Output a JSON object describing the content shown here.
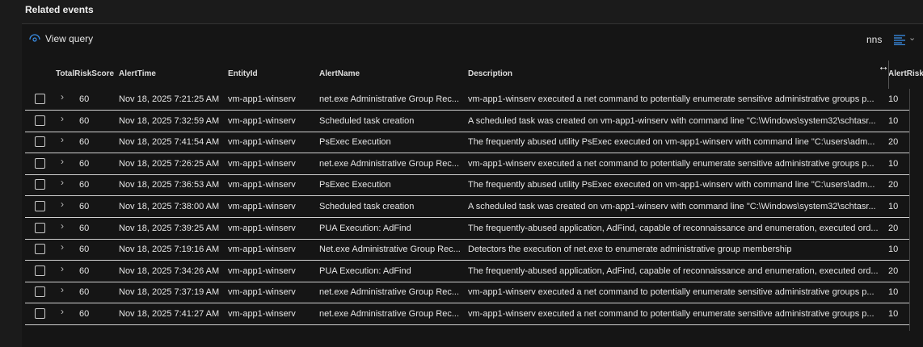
{
  "section_title": "Related events",
  "toolbar": {
    "view_query": "View query",
    "columns_label": "nns"
  },
  "columns": [
    "TotalRiskScore",
    "AlertTime",
    "EntityId",
    "AlertName",
    "Description",
    "AlertRiskS"
  ],
  "rows": [
    [
      "60",
      "Nov 18, 2025 7:21:25 AM",
      "vm-app1-winserv",
      "net.exe Administrative Group Rec...",
      "vm-app1-winserv executed a net command to potentially enumerate sensitive administrative groups p...",
      "10"
    ],
    [
      "60",
      "Nov 18, 2025 7:32:59 AM",
      "vm-app1-winserv",
      "Scheduled task creation",
      "A scheduled task was created on vm-app1-winserv with command line \"C:\\Windows\\system32\\schtasr...",
      "10"
    ],
    [
      "60",
      "Nov 18, 2025 7:41:54 AM",
      "vm-app1-winserv",
      "PsExec Execution",
      "The frequently abused utility PsExec executed on vm-app1-winserv with command line \"C:\\users\\adm...",
      "20"
    ],
    [
      "60",
      "Nov 18, 2025 7:26:25 AM",
      "vm-app1-winserv",
      "net.exe Administrative Group Rec...",
      "vm-app1-winserv executed a net command to potentially enumerate sensitive administrative groups p...",
      "10"
    ],
    [
      "60",
      "Nov 18, 2025 7:36:53 AM",
      "vm-app1-winserv",
      "PsExec Execution",
      "The frequently abused utility PsExec executed on vm-app1-winserv with command line \"C:\\users\\adm...",
      "20"
    ],
    [
      "60",
      "Nov 18, 2025 7:38:00 AM",
      "vm-app1-winserv",
      "Scheduled task creation",
      "A scheduled task was created on vm-app1-winserv with command line \"C:\\Windows\\system32\\schtasr...",
      "10"
    ],
    [
      "60",
      "Nov 18, 2025 7:39:25 AM",
      "vm-app1-winserv",
      "PUA Execution: AdFind",
      "The frequently-abused application, AdFind, capable of reconnaissance and enumeration, executed ord...",
      "20"
    ],
    [
      "60",
      "Nov 18, 2025 7:19:16 AM",
      "vm-app1-winserv",
      "Net.exe Administrative Group Rec...",
      "Detectors the execution of net.exe to enumerate administrative group membership",
      "10"
    ],
    [
      "60",
      "Nov 18, 2025 7:34:26 AM",
      "vm-app1-winserv",
      "PUA Execution: AdFind",
      "The frequently-abused application, AdFind, capable of reconnaissance and enumeration, executed ord...",
      "20"
    ],
    [
      "60",
      "Nov 18, 2025 7:37:19 AM",
      "vm-app1-winserv",
      "net.exe Administrative Group Rec...",
      "vm-app1-winserv executed a net command to potentially enumerate sensitive administrative groups p...",
      "10"
    ],
    [
      "60",
      "Nov 18, 2025 7:41:27 AM",
      "vm-app1-winserv",
      "net.exe Administrative Group Rec...",
      "vm-app1-winserv executed a net command to potentially enumerate sensitive administrative groups p...",
      "10"
    ]
  ],
  "colors": {
    "accent": "#3a8ee6"
  }
}
